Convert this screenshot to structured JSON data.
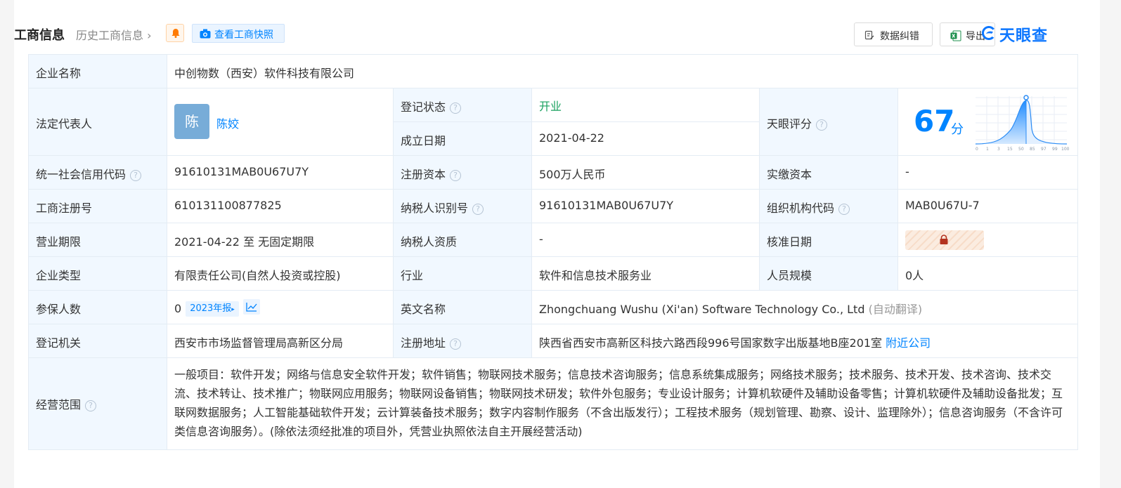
{
  "header": {
    "title": "工商信息",
    "history": "历史工商信息",
    "snapshot": "查看工商快照",
    "correct": "数据纠错",
    "export": "导出",
    "brand": "天眼查"
  },
  "rows": {
    "company_name_label": "企业名称",
    "company_name": "中创物数（西安）软件科技有限公司",
    "legal_rep_label": "法定代表人",
    "legal_rep_avatar": "陈",
    "legal_rep": "陈姣",
    "reg_status_label": "登记状态",
    "reg_status": "开业",
    "est_date_label": "成立日期",
    "est_date": "2021-04-22",
    "score_label": "天眼评分",
    "score": "67",
    "score_unit": "分",
    "score_ticks": [
      "0",
      "1",
      "3",
      "15",
      "50",
      "85",
      "97",
      "99",
      "100"
    ],
    "credit_code_label": "统一社会信用代码",
    "credit_code": "91610131MAB0U67U7Y",
    "reg_capital_label": "注册资本",
    "reg_capital": "500万人民币",
    "paid_capital_label": "实缴资本",
    "paid_capital": "-",
    "reg_no_label": "工商注册号",
    "reg_no": "610131100877825",
    "taxpayer_id_label": "纳税人识别号",
    "taxpayer_id": "91610131MAB0U67U7Y",
    "org_code_label": "组织机构代码",
    "org_code": "MAB0U67U-7",
    "term_label": "营业期限",
    "term": "2021-04-22 至 无固定期限",
    "taxpayer_qual_label": "纳税人资质",
    "taxpayer_qual": "-",
    "approve_date_label": "核准日期",
    "type_label": "企业类型",
    "type": "有限责任公司(自然人投资或控股)",
    "industry_label": "行业",
    "industry": "软件和信息技术服务业",
    "staff_label": "人员规模",
    "staff": "0人",
    "insured_label": "参保人数",
    "insured": "0",
    "insured_report": "2023年报",
    "en_name_label": "英文名称",
    "en_name": "Zhongchuang Wushu (Xi'an) Software Technology Co., Ltd",
    "en_name_note": "(自动翻译)",
    "authority_label": "登记机关",
    "authority": "西安市市场监督管理局高新区分局",
    "address_label": "注册地址",
    "address": "陕西省西安市高新区科技六路西段996号国家数字出版基地B座201室",
    "nearby": "附近公司",
    "scope_label": "经营范围",
    "scope": "一般项目：软件开发；网络与信息安全软件开发；软件销售；物联网技术服务；信息技术咨询服务；信息系统集成服务；网络技术服务；技术服务、技术开发、技术咨询、技术交流、技术转让、技术推广；物联网应用服务；物联网设备销售；物联网技术研发；软件外包服务；专业设计服务；计算机软硬件及辅助设备零售；计算机软硬件及辅助设备批发；互联网数据服务；人工智能基础软件开发；云计算装备技术服务；数字内容制作服务（不含出版发行）；工程技术服务（规划管理、勘察、设计、监理除外）；信息咨询服务（不含许可类信息咨询服务）。(除依法须经批准的项目外，凭营业执照依法自主开展经营活动)"
  },
  "colors": {
    "accent": "#0084ff",
    "open_status": "#19a15f",
    "label_bg": "#f1f8ff"
  }
}
